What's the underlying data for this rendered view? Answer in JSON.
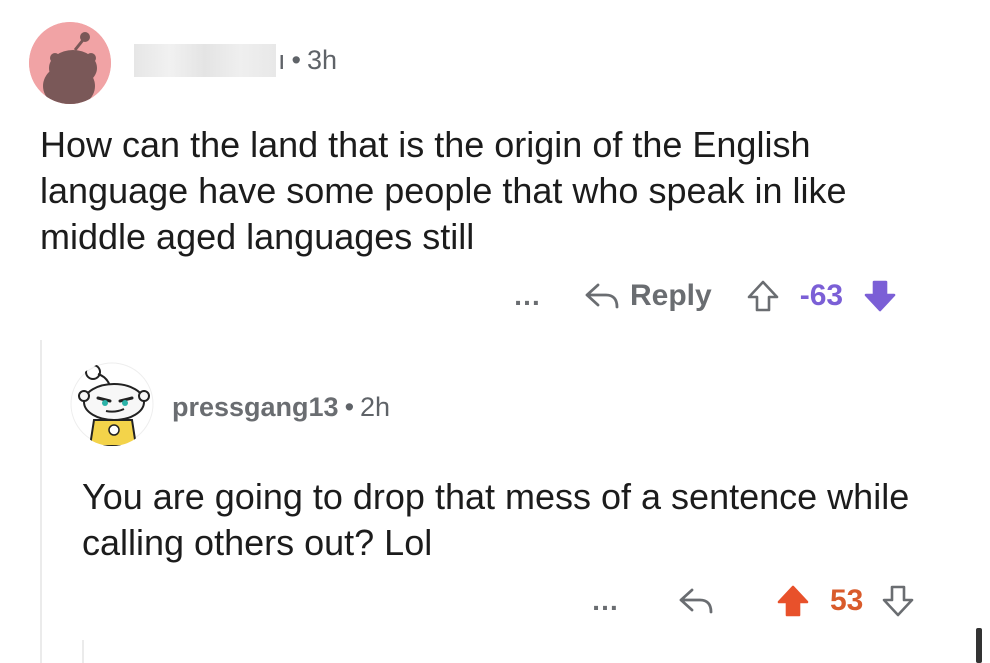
{
  "comment1": {
    "username_fragment": "ı",
    "time": "3h",
    "text": "How can the land that is the origin of the English language have some people that who speak in like middle aged languages still",
    "actions": {
      "more": "…",
      "reply_label": "Reply",
      "score": "-63"
    },
    "vote_state": "downvoted",
    "colors": {
      "avatar_bg": "#f1a3a5",
      "score": "#7b5fd6"
    }
  },
  "comment2": {
    "username": "pressgang13",
    "time": "2h",
    "text": "You are going to drop that mess of a sentence while calling others out? Lol",
    "actions": {
      "more": "…",
      "score": "53"
    },
    "vote_state": "upvoted",
    "colors": {
      "score": "#d95b2b"
    }
  },
  "separator": "•",
  "icons": {
    "avatar1": "snoo-avatar-icon",
    "avatar2": "snoo-avatar-icon",
    "reply": "reply-arrow-icon",
    "upvote": "upvote-arrow-icon",
    "downvote": "downvote-arrow-icon"
  }
}
